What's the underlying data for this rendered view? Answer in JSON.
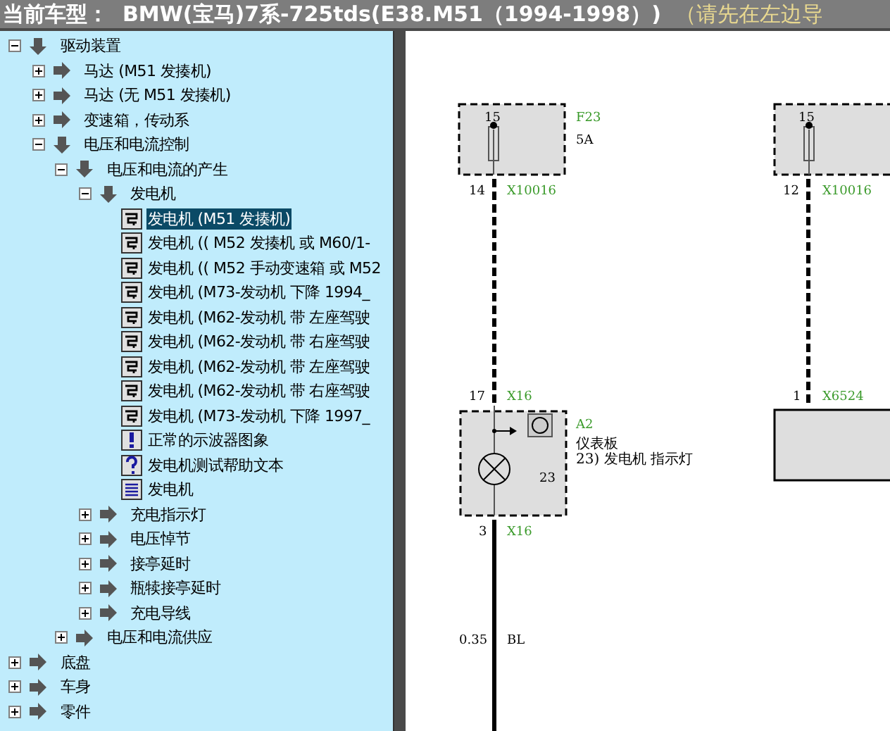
{
  "header": {
    "label": "当前车型：",
    "vehicle": "BMW(宝马)7系-725tds(E38.M51（1994-1998）)",
    "hint": "（请先在左边导"
  },
  "tree": [
    {
      "kind": "folder",
      "label": "驱动装置",
      "expanded": true,
      "selected": false,
      "children": [
        {
          "kind": "folder",
          "label": "马达 (M51 发揍机)",
          "expanded": false,
          "selected": false
        },
        {
          "kind": "folder",
          "label": "马达 (无 M51 发揍机)",
          "expanded": false,
          "selected": false
        },
        {
          "kind": "folder",
          "label": "变速箱，传动系",
          "expanded": false,
          "selected": false
        },
        {
          "kind": "folder",
          "label": "电压和电流控制",
          "expanded": true,
          "selected": false,
          "children": [
            {
              "kind": "folder",
              "label": "电压和电流的产生",
              "expanded": true,
              "selected": false,
              "children": [
                {
                  "kind": "folder",
                  "label": "发电机",
                  "expanded": true,
                  "selected": false,
                  "children": [
                    {
                      "kind": "diagram",
                      "label": "发电机 (M51 发揍机)",
                      "selected": true
                    },
                    {
                      "kind": "diagram",
                      "label": "发电机 (( M52 发揍机 或 M60/1-",
                      "selected": false
                    },
                    {
                      "kind": "diagram",
                      "label": "发电机 (( M52 手动变速箱 或 M52",
                      "selected": false
                    },
                    {
                      "kind": "diagram",
                      "label": "发电机 (M73-发动机 下降 1994_",
                      "selected": false
                    },
                    {
                      "kind": "diagram",
                      "label": "发电机 (M62-发动机 带 左座驾驶",
                      "selected": false
                    },
                    {
                      "kind": "diagram",
                      "label": "发电机 (M62-发动机 带 右座驾驶",
                      "selected": false
                    },
                    {
                      "kind": "diagram",
                      "label": "发电机 (M62-发动机 带 左座驾驶",
                      "selected": false
                    },
                    {
                      "kind": "diagram",
                      "label": "发电机 (M62-发动机 带 右座驾驶",
                      "selected": false
                    },
                    {
                      "kind": "diagram",
                      "label": "发电机 (M73-发动机 下降 1997_",
                      "selected": false
                    },
                    {
                      "kind": "note",
                      "label": "正常的示波器图象",
                      "selected": false
                    },
                    {
                      "kind": "help",
                      "label": "发电机测试帮助文本",
                      "selected": false
                    },
                    {
                      "kind": "document",
                      "label": "发电机",
                      "selected": false
                    }
                  ]
                },
                {
                  "kind": "folder",
                  "label": "充电指示灯",
                  "expanded": false,
                  "selected": false
                },
                {
                  "kind": "folder",
                  "label": "电压悼节",
                  "expanded": false,
                  "selected": false
                },
                {
                  "kind": "folder",
                  "label": "接亭延时",
                  "expanded": false,
                  "selected": false
                },
                {
                  "kind": "folder",
                  "label": "瓶犊接亭延时",
                  "expanded": false,
                  "selected": false
                },
                {
                  "kind": "folder",
                  "label": "充电导线",
                  "expanded": false,
                  "selected": false
                }
              ]
            },
            {
              "kind": "folder",
              "label": "电压和电流供应",
              "expanded": false,
              "selected": false
            }
          ]
        }
      ]
    },
    {
      "kind": "folder",
      "label": "底盘",
      "expanded": false,
      "selected": false
    },
    {
      "kind": "folder",
      "label": "车身",
      "expanded": false,
      "selected": false
    },
    {
      "kind": "folder",
      "label": "零件",
      "expanded": false,
      "selected": false
    }
  ],
  "diagram": {
    "fuse_left": {
      "pin": "15",
      "name": "F23",
      "rating": "5A",
      "out_pin": "14",
      "out_connector": "X10016"
    },
    "fuse_right": {
      "pin": "15",
      "out_pin": "12",
      "out_connector": "X10016"
    },
    "instrument": {
      "in_pin": "17",
      "in_connector": "X16",
      "name": "A2",
      "title": "仪表板",
      "description": "23)  发电机  指示灯",
      "number": "23",
      "out_pin": "3",
      "out_connector": "X16"
    },
    "right_module": {
      "in_pin": "1",
      "in_connector": "X6524"
    },
    "wire": {
      "size": "0.35",
      "color_code": "BL"
    }
  }
}
